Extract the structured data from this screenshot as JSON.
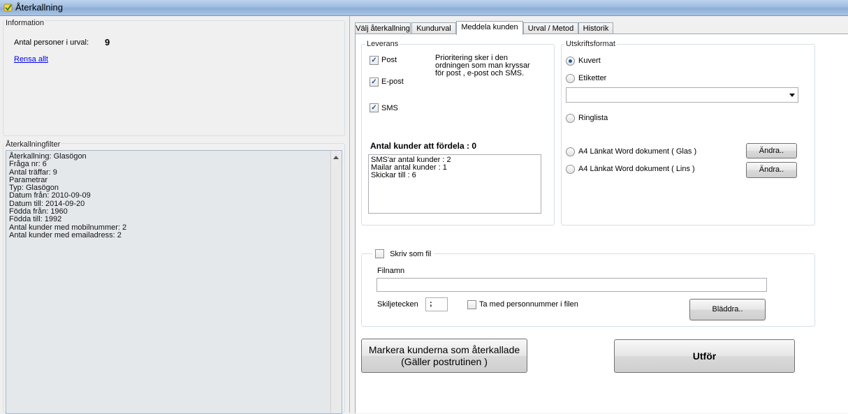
{
  "window": {
    "title": "Återkallning"
  },
  "information": {
    "legend": "Information",
    "count_label": "Antal personer i urval:",
    "count_value": "9",
    "clear_link": "Rensa allt"
  },
  "filter": {
    "legend": "Återkallningfilter",
    "lines": [
      "Återkallning: Glasögon",
      "Fråga nr: 6",
      "Antal träffar: 9",
      "Parametrar",
      "Typ: Glasögon",
      "Datum från: 2010-09-09",
      "Datum till: 2014-09-20",
      "Födda från: 1960",
      "Födda till: 1992",
      "Antal kunder med mobilnummer: 2",
      "Antal kunder med emailadress: 2"
    ]
  },
  "tabs": [
    {
      "label": "Välj återkallning",
      "active": false
    },
    {
      "label": "Kundurval",
      "active": false
    },
    {
      "label": "Meddela kunden",
      "active": true
    },
    {
      "label": "Urval / Metod",
      "active": false
    },
    {
      "label": "Historik",
      "active": false
    }
  ],
  "leverans": {
    "legend": "Leverans",
    "post_label": "Post",
    "post_checked": true,
    "epost_label": "E-post",
    "epost_checked": true,
    "sms_label": "SMS",
    "sms_checked": true,
    "priority_text": [
      "Prioritering sker i den",
      "ordningen som man kryssar",
      "för post , e-post och SMS."
    ],
    "distribute_label": "Antal kunder att fördela : 0",
    "summary_lines": [
      "SMS'ar antal kunder : 2",
      "Mailar antal kunder : 1",
      "Skickar till  : 6"
    ]
  },
  "utskrift": {
    "legend": "Utskriftsformat",
    "kuvert_label": "Kuvert",
    "etiketter_label": "Etiketter",
    "selected": "Kuvert",
    "dropdown_value": "",
    "ringlista_label": "Ringlista",
    "a4_glas_label": "A4 Länkat Word dokument ( Glas )",
    "a4_lins_label": "A4 Länkat Word dokument ( Lins )",
    "andra_label": "Ändra.."
  },
  "file": {
    "write_file_label": "Skriv som fil",
    "write_file_checked": false,
    "filename_label": "Filnamn",
    "filename_value": "",
    "separator_label": "Skiljetecken",
    "separator_value": ";",
    "include_ssn_label": "Ta med personnummer i filen",
    "include_ssn_checked": false,
    "browse_label": "Bläddra.."
  },
  "actions": {
    "mark_label_line1": "Markera kunderna som återkallade",
    "mark_label_line2": "(Gäller postrutinen )",
    "execute_label": "Utför"
  },
  "colors": {
    "titlebar": "#9fbde0",
    "link": "#0000ee",
    "radio_dot": "#1c5aa8"
  }
}
